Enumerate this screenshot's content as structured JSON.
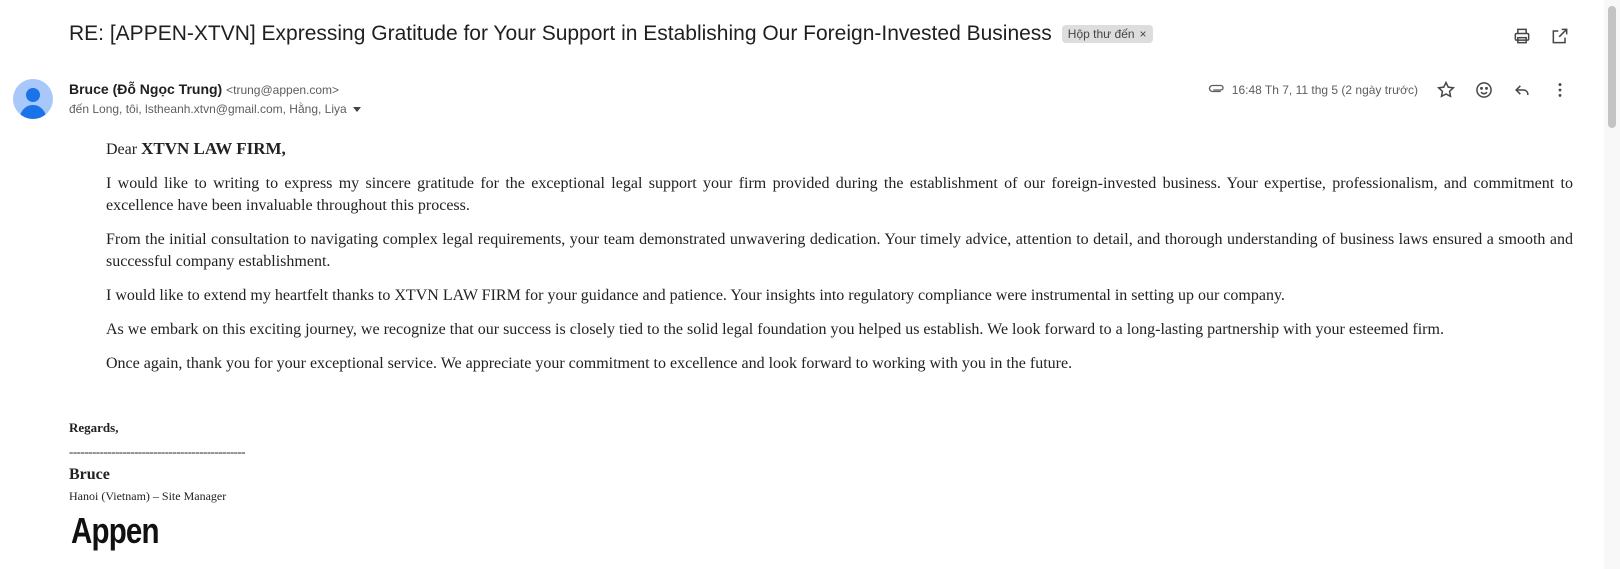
{
  "email": {
    "subject": "RE: [APPEN-XTVN] Expressing Gratitude for Your Support in Establishing Our Foreign-Invested Business",
    "label": "Hộp thư đến",
    "label_remove": "×"
  },
  "sender": {
    "name": "Bruce (Đỗ Ngọc Trung)",
    "email": "<trung@appen.com>",
    "recipients": "đến Long, tôi, lstheanh.xtvn@gmail.com, Hằng, Liya"
  },
  "meta": {
    "timestamp": "16:48 Th 7, 11 thg 5 (2 ngày trước)"
  },
  "body": {
    "greeting_prefix": "Dear ",
    "greeting_name": "XTVN LAW FIRM,",
    "paragraphs": [
      "I would like to writing to express my sincere gratitude for the exceptional legal support your firm provided during the establishment of our foreign-invested business. Your expertise, professionalism, and commitment to excellence have been invaluable throughout this process.",
      "From the initial consultation to navigating complex legal requirements, your team demonstrated unwavering dedication. Your timely advice, attention to detail, and thorough understanding of business laws ensured a smooth and successful company establishment.",
      "I would like to extend my heartfelt thanks to XTVN LAW FIRM for your guidance and patience. Your insights into regulatory compliance were instrumental in setting up our company.",
      "As we embark on this exciting journey, we recognize that our success is closely tied to the solid legal foundation you helped us establish. We look forward to a long-lasting partnership with your esteemed firm.",
      "Once again, thank you for your exceptional service. We appreciate your commitment to excellence and look forward to working with you in the future."
    ]
  },
  "signature": {
    "regards": "Regards,",
    "rule": "----------------------------------------------",
    "name": "Bruce",
    "title": "Hanoi (Vietnam) – Site Manager",
    "logo": "Appen"
  },
  "icons": {
    "print": "print-icon",
    "open_new": "open-in-new-window-icon",
    "attachment": "attachment-icon",
    "star": "star-icon",
    "emoji": "emoji-icon",
    "reply": "reply-icon",
    "more": "more-vertical-icon",
    "avatar": "avatar"
  }
}
